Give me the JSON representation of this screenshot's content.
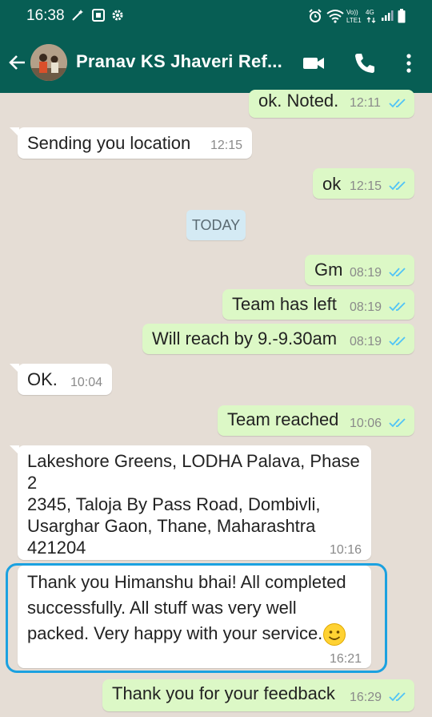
{
  "status_bar": {
    "time": "16:38"
  },
  "header": {
    "contact_name": "Pranav KS Jhaveri Ref..."
  },
  "date_divider": "TODAY",
  "messages": [
    {
      "dir": "out",
      "text": "ok. Noted.",
      "time": "12:11"
    },
    {
      "dir": "in",
      "text": "Sending you location",
      "time": "12:15"
    },
    {
      "dir": "out",
      "text": "ok",
      "time": "12:15"
    },
    {
      "dir": "out",
      "text": "Gm",
      "time": "08:19"
    },
    {
      "dir": "out",
      "text": "Team has left",
      "time": "08:19"
    },
    {
      "dir": "out",
      "text": "Will reach by 9.-9.30am",
      "time": "08:19"
    },
    {
      "dir": "in",
      "text": "OK.",
      "time": "10:04"
    },
    {
      "dir": "out",
      "text": "Team reached",
      "time": "10:06"
    },
    {
      "dir": "in",
      "lines": [
        "Lakeshore Greens, LODHA Palava, Phase",
        "2",
        "2345, Taloja By Pass Road, Dombivli,",
        "Usarghar Gaon, Thane, Maharashtra",
        "421204"
      ],
      "time": "10:16"
    },
    {
      "dir": "in",
      "lines": [
        "Thank you Himanshu bhai! All completed",
        "successfully. All stuff was very well",
        "packed. Very  happy with your service."
      ],
      "time": "16:21"
    },
    {
      "dir": "out",
      "text": "Thank you for your feedback",
      "time": "16:29"
    }
  ],
  "colors": {
    "header": "#075e54",
    "outgoing": "#dcf8c6",
    "incoming": "#ffffff",
    "chat_bg": "#e5ddd5",
    "read_ticks": "#4fc3f7",
    "highlight": "#1ba1e0"
  }
}
